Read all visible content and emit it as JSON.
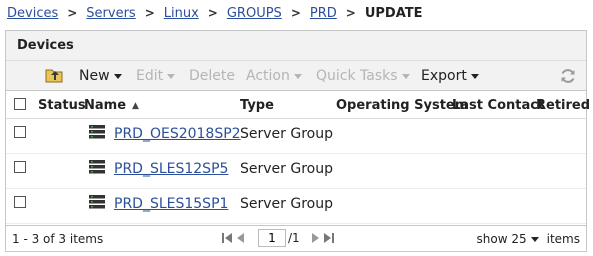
{
  "breadcrumb": {
    "items": [
      "Devices",
      "Servers",
      "Linux",
      "GROUPS",
      "PRD"
    ],
    "current": "UPDATE"
  },
  "panel": {
    "title": "Devices"
  },
  "toolbar": {
    "new": "New",
    "edit": "Edit",
    "delete": "Delete",
    "action": "Action",
    "quick_tasks": "Quick Tasks",
    "export": "Export"
  },
  "table": {
    "columns": {
      "status": "Status",
      "name": "Name",
      "type": "Type",
      "os": "Operating System",
      "last_contact": "Last Contact",
      "retired": "Retired"
    },
    "rows": [
      {
        "name": "PRD_OES2018SP2",
        "type": "Server Group"
      },
      {
        "name": "PRD_SLES12SP5",
        "type": "Server Group"
      },
      {
        "name": "PRD_SLES15SP1",
        "type": "Server Group"
      }
    ]
  },
  "footer": {
    "count": "1 - 3 of 3 items",
    "page": "1",
    "total_pages": "/1",
    "show_label": "show",
    "show_value": "25",
    "items_label": "items"
  },
  "colors": {
    "link": "#2b4f9a",
    "disabled": "#b5b5b5",
    "header_bg": "#f2f2f2"
  }
}
